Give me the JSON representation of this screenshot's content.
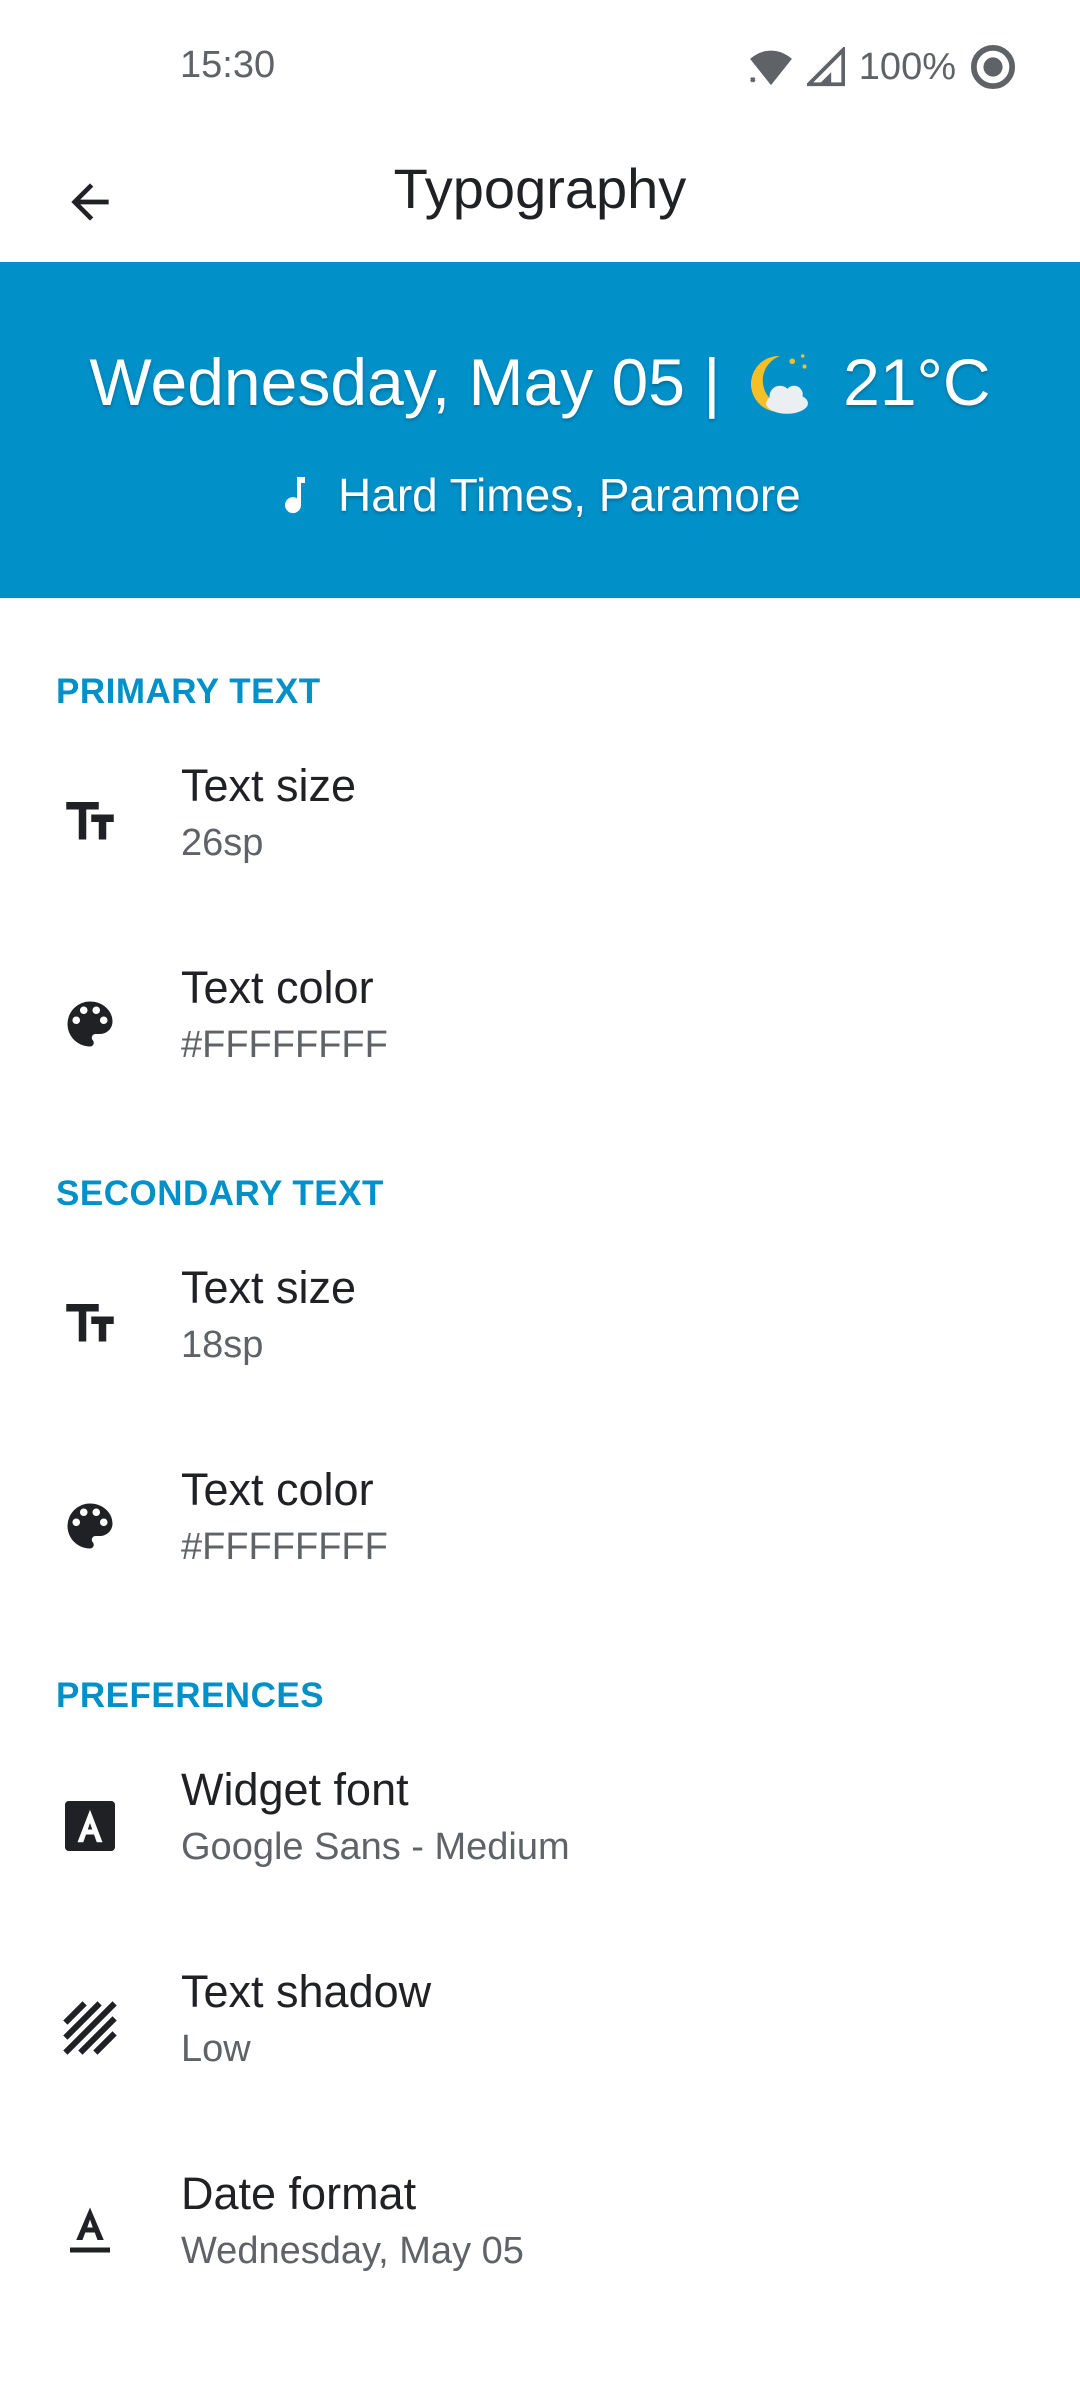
{
  "status_bar": {
    "time": "15:30",
    "battery": "100%"
  },
  "app_bar": {
    "title": "Typography",
    "back_icon": "arrow-back-icon"
  },
  "preview": {
    "background_color": "#0190C8",
    "date_text": "Wednesday, May 05 |",
    "temperature": "21°C",
    "weather_icon": "partly-cloudy-night-icon",
    "music_icon": "music-note-icon",
    "song_text": "Hard Times, Paramore"
  },
  "sections": {
    "primary": {
      "header": "PRIMARY TEXT",
      "size": {
        "icon": "text-size-icon",
        "title": "Text size",
        "summary": "26sp"
      },
      "color": {
        "icon": "palette-icon",
        "title": "Text color",
        "summary": "#FFFFFFFF"
      }
    },
    "secondary": {
      "header": "SECONDARY TEXT",
      "size": {
        "icon": "text-size-icon",
        "title": "Text size",
        "summary": "18sp"
      },
      "color": {
        "icon": "palette-icon",
        "title": "Text color",
        "summary": "#FFFFFFFF"
      }
    },
    "preferences": {
      "header": "PREFERENCES",
      "font": {
        "icon": "font-icon",
        "title": "Widget font",
        "summary": "Google Sans - Medium"
      },
      "shadow": {
        "icon": "texture-icon",
        "title": "Text shadow",
        "summary": "Low"
      },
      "date_format": {
        "icon": "text-format-icon",
        "title": "Date format",
        "summary": "Wednesday, May 05"
      }
    }
  },
  "colors": {
    "accent": "#0190C8",
    "primary_text": "#202124",
    "secondary_text": "#5f6368"
  }
}
